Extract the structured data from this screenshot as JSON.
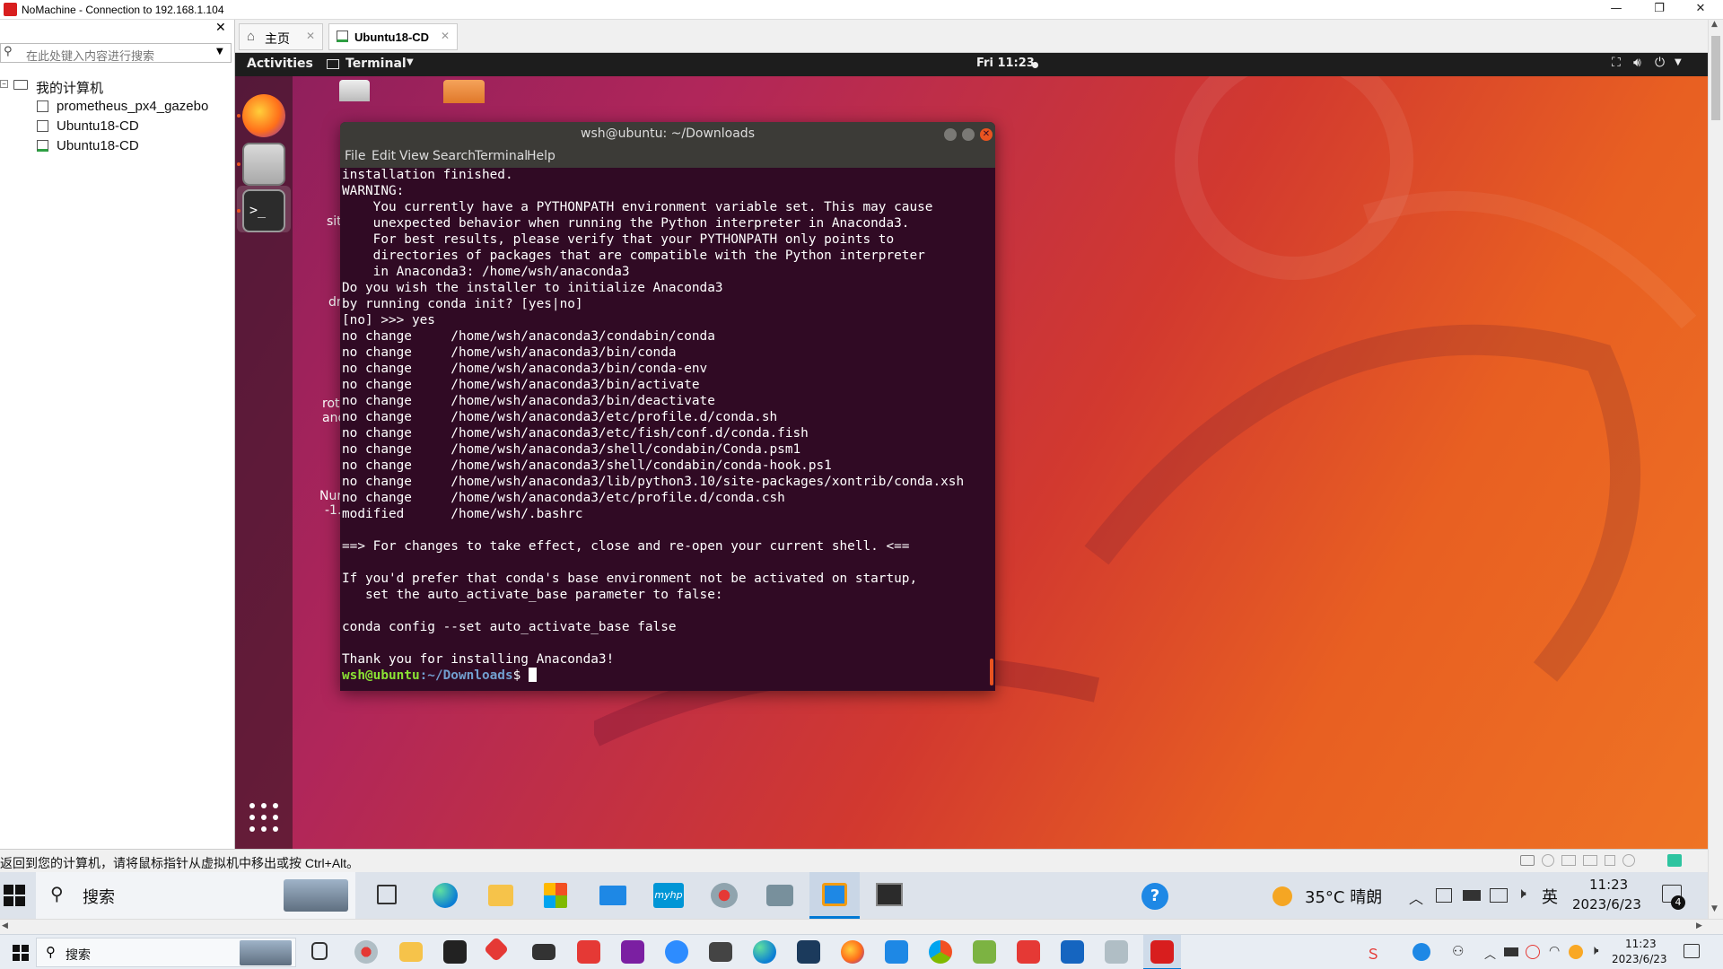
{
  "host": {
    "title": "NoMachine - Connection to 192.168.1.104",
    "search_placeholder": "在此处键入内容进行搜索",
    "tree_root": "我的计算机",
    "tree_items": [
      "prometheus_px4_gazebo",
      "Ubuntu18-CD",
      "Ubuntu18-CD"
    ],
    "tabs": [
      {
        "label": "主页"
      },
      {
        "label": "Ubuntu18-CD"
      }
    ],
    "status_text": "返回到您的计算机，请将鼠标指针从虚拟机中移出或按 Ctrl+Alt。"
  },
  "ubuntu": {
    "activities": "Activities",
    "app_menu": "Terminal",
    "clock": "Fri 11:23",
    "desktop_labels": [
      "sit",
      "dr",
      "rot",
      "and",
      "Nur",
      "-1."
    ],
    "terminal": {
      "title": "wsh@ubuntu: ~/Downloads",
      "menu": [
        "File",
        "Edit",
        "View",
        "Search",
        "Terminal",
        "Help"
      ],
      "lines": [
        "installation finished.",
        "WARNING:",
        "    You currently have a PYTHONPATH environment variable set. This may cause",
        "    unexpected behavior when running the Python interpreter in Anaconda3.",
        "    For best results, please verify that your PYTHONPATH only points to",
        "    directories of packages that are compatible with the Python interpreter",
        "    in Anaconda3: /home/wsh/anaconda3",
        "Do you wish the installer to initialize Anaconda3",
        "by running conda init? [yes|no]",
        "[no] >>> yes",
        "no change     /home/wsh/anaconda3/condabin/conda",
        "no change     /home/wsh/anaconda3/bin/conda",
        "no change     /home/wsh/anaconda3/bin/conda-env",
        "no change     /home/wsh/anaconda3/bin/activate",
        "no change     /home/wsh/anaconda3/bin/deactivate",
        "no change     /home/wsh/anaconda3/etc/profile.d/conda.sh",
        "no change     /home/wsh/anaconda3/etc/fish/conf.d/conda.fish",
        "no change     /home/wsh/anaconda3/shell/condabin/Conda.psm1",
        "no change     /home/wsh/anaconda3/shell/condabin/conda-hook.ps1",
        "no change     /home/wsh/anaconda3/lib/python3.10/site-packages/xontrib/conda.xsh",
        "no change     /home/wsh/anaconda3/etc/profile.d/conda.csh",
        "modified      /home/wsh/.bashrc",
        "",
        "==> For changes to take effect, close and re-open your current shell. <==",
        "",
        "If you'd prefer that conda's base environment not be activated on startup,",
        "   set the auto_activate_base parameter to false:",
        "",
        "conda config --set auto_activate_base false",
        "",
        "Thank you for installing Anaconda3!"
      ],
      "prompt_user": "wsh@ubuntu",
      "prompt_path": ":~/Downloads",
      "prompt_symbol": "$ "
    }
  },
  "inner_taskbar": {
    "search": "搜索",
    "weather": "35°C 晴朗",
    "ime": "英",
    "time": "11:23",
    "date": "2023/6/23",
    "notif_count": "4"
  },
  "outer_taskbar": {
    "search": "搜索",
    "time": "11:23",
    "date": "2023/6/23"
  },
  "colors": {
    "terminal_bg": "#300a24",
    "prompt_green": "#8ae234",
    "prompt_blue": "#729fcf",
    "ubuntu_orange": "#e95420"
  }
}
